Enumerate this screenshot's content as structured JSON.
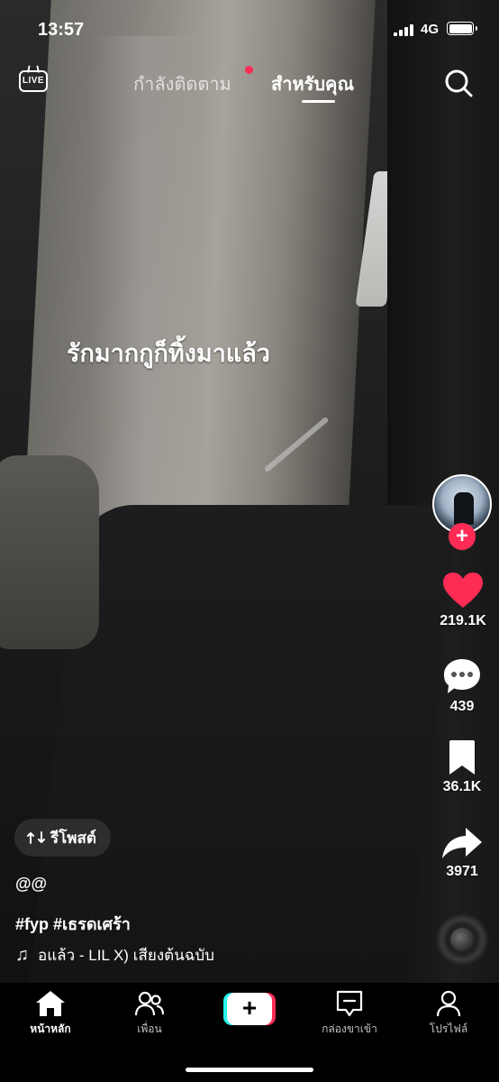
{
  "status_bar": {
    "time": "13:57",
    "network": "4G",
    "battery_level": 1.0
  },
  "top_nav": {
    "live_label": "LIVE",
    "tab_following": "กำลังติดตาม",
    "tab_for_you": "สำหรับคุณ",
    "active_tab": "tab_for_you",
    "search_icon": "search-icon"
  },
  "video": {
    "caption": "รักมากกูก็ทิ้งมาแล้ว"
  },
  "actions": {
    "likes": "219.1K",
    "comments": "439",
    "bookmarks": "36.1K",
    "shares": "3971",
    "follow_plus": "+",
    "like_color": "#fe2c55"
  },
  "post": {
    "repost_label": "รีโพสต์",
    "username": "@@",
    "hashtags": "#fyp #เธรดเศร้า",
    "music_note": "♫",
    "music_text": "อแล้ว - LIL X)   เสียงต้นฉบับ"
  },
  "bottom_nav": {
    "home": "หน้าหลัก",
    "friends": "เพื่อน",
    "create": "+",
    "inbox": "กล่องขาเข้า",
    "profile": "โปรไฟล์",
    "active": "home"
  }
}
